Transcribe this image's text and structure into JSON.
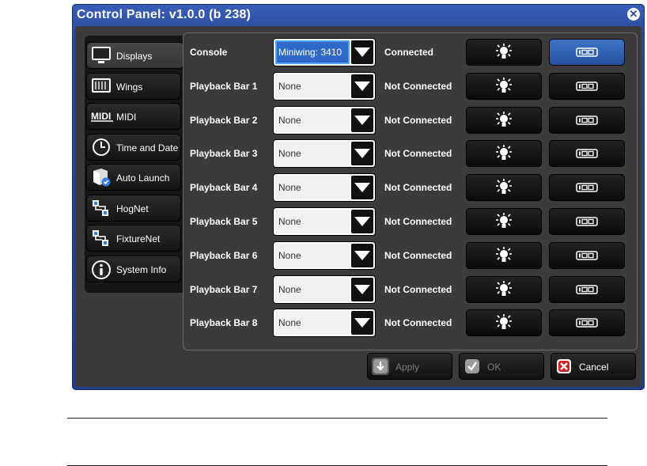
{
  "window": {
    "title": "Control Panel: v1.0.0 (b 238)"
  },
  "sidebar": {
    "items": [
      {
        "label": "Displays",
        "icon": "monitor-icon",
        "active": true
      },
      {
        "label": "Wings",
        "icon": "wing-icon",
        "active": false
      },
      {
        "label": "MIDI",
        "icon": "midi-icon",
        "active": false
      },
      {
        "label": "Time and Date",
        "icon": "clock-icon",
        "active": false
      },
      {
        "label": "Auto Launch",
        "icon": "auto-launch-icon",
        "active": false
      },
      {
        "label": "HogNet",
        "icon": "network-icon",
        "active": false
      },
      {
        "label": "FixtureNet",
        "icon": "network-icon",
        "active": false
      },
      {
        "label": "System Info",
        "icon": "info-icon",
        "active": false
      }
    ]
  },
  "rows": [
    {
      "label": "Console",
      "value": "Miniwing: 3410",
      "status": "Connected",
      "selected": true
    },
    {
      "label": "Playback Bar 1",
      "value": "None",
      "status": "Not Connected",
      "selected": false
    },
    {
      "label": "Playback Bar 2",
      "value": "None",
      "status": "Not Connected",
      "selected": false
    },
    {
      "label": "Playback Bar 3",
      "value": "None",
      "status": "Not Connected",
      "selected": false
    },
    {
      "label": "Playback Bar 4",
      "value": "None",
      "status": "Not Connected",
      "selected": false
    },
    {
      "label": "Playback Bar 5",
      "value": "None",
      "status": "Not Connected",
      "selected": false
    },
    {
      "label": "Playback Bar 6",
      "value": "None",
      "status": "Not Connected",
      "selected": false
    },
    {
      "label": "Playback Bar 7",
      "value": "None",
      "status": "Not Connected",
      "selected": false
    },
    {
      "label": "Playback Bar 8",
      "value": "None",
      "status": "Not Connected",
      "selected": false
    }
  ],
  "buttons": {
    "apply": "Apply",
    "ok": "OK",
    "cancel": "Cancel"
  },
  "colors": {
    "title_bar": "#2a4a9c",
    "selected_blue": "#2f69c8",
    "cancel_red": "#d21f1f"
  }
}
